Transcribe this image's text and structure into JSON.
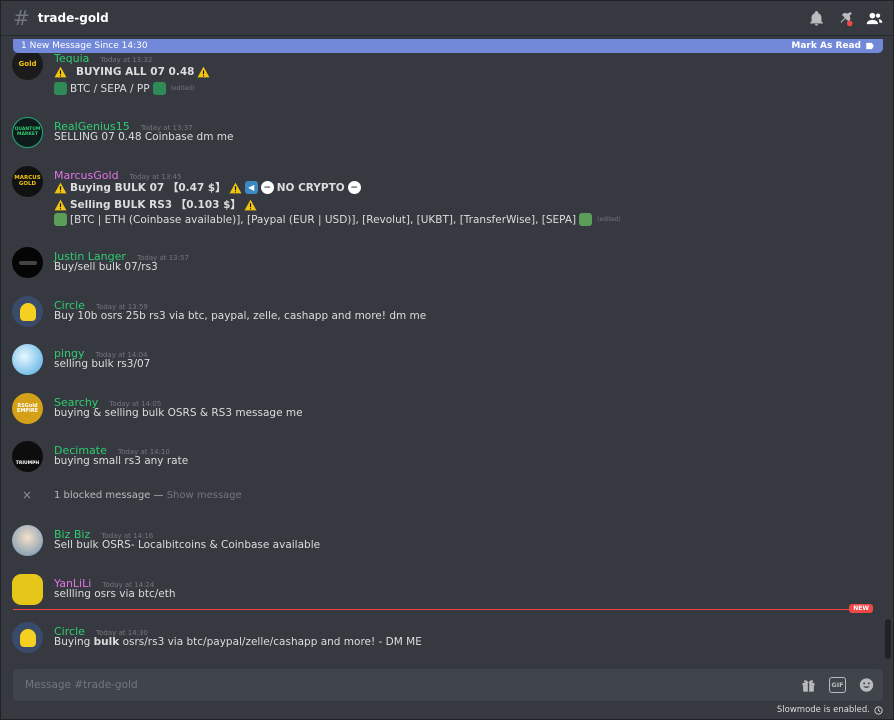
{
  "header": {
    "channel": "trade-gold",
    "icons": [
      "bell-icon",
      "pin-icon",
      "members-icon"
    ]
  },
  "new_bar": {
    "text": "1 New Message Since 14:30",
    "mark_read": "Mark As Read"
  },
  "messages": [
    {
      "user": "Tequia",
      "time": "Today at 13:32",
      "color": "#2ecc71",
      "lines": [
        "BUYING ALL 07 0.48",
        "BTC / SEPA / PP"
      ],
      "edited": "(edited)"
    },
    {
      "user": "RealGenius15",
      "time": "Today at 13:37",
      "color": "#2ecc71",
      "lines": [
        "SELLING 07 0.48 Coinbase dm me"
      ]
    },
    {
      "user": "MarcusGold",
      "time": "Today at 13:45",
      "color": "#e074e6",
      "lines": [
        "Buying  BULK 07 【0.47 $】",
        "NO CRYPTO",
        "Selling  BULK RS3 【0.103 $】",
        "[BTC | ETH (Coinbase available)], [Paypal (EUR | USD)], [Revolut], [UKBT], [TransferWise], [SEPA]"
      ],
      "edited": "(edited)",
      "avatar_text": "MARCUS GOLD"
    },
    {
      "user": "Justin Langer",
      "time": "Today at 13:57",
      "color": "#2ecc71",
      "lines": [
        "Buy/sell bulk 07/rs3"
      ]
    },
    {
      "user": "Circle",
      "time": "Today at 13:59",
      "color": "#2ecc71",
      "lines": [
        "Buy 10b osrs 25b rs3 via btc, paypal, zelle, cashapp and more! dm me"
      ]
    },
    {
      "user": "pingy",
      "time": "Today at 14:04",
      "color": "#2ecc71",
      "lines": [
        "selling bulk rs3/07"
      ]
    },
    {
      "user": "Searchy",
      "time": "Today at 14:05",
      "color": "#2ecc71",
      "lines": [
        "buying & selling bulk OSRS & RS3 message me"
      ],
      "avatar_text": "RSGold EMPIRE"
    },
    {
      "user": "Decimate",
      "time": "Today at 14:10",
      "color": "#2ecc71",
      "lines": [
        "buying small rs3 any rate"
      ],
      "avatar_text": "TRIUMPH"
    },
    {
      "user": "Biz Biz",
      "time": "Today at 14:16",
      "color": "#2ecc71",
      "lines": [
        "Sell bulk OSRS- Localbitcoins & Coinbase available"
      ]
    },
    {
      "user": "YanLiLi",
      "time": "Today at 14:24",
      "color": "#e074e6",
      "lines": [
        "sellling osrs via btc/eth"
      ]
    },
    {
      "user": "Circle",
      "time": "Today at 14:30",
      "color": "#2ecc71",
      "lines_prefix": "Buying ",
      "lines_bold": "bulk",
      "lines_suffix": " osrs/rs3 via btc/paypal/zelle/cashapp and more! - DM ME"
    }
  ],
  "blocked": {
    "text": "1 blocked message — ",
    "link": "Show message"
  },
  "new_pill": "NEW",
  "input": {
    "placeholder": "Message #trade-gold",
    "gif": "GIF"
  },
  "slowmode": "Slowmode is enabled."
}
